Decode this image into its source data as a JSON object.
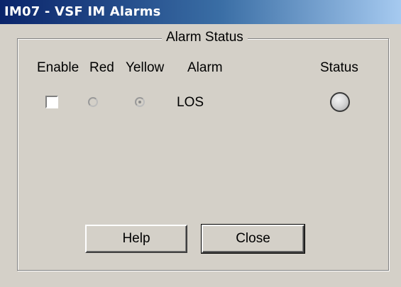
{
  "window": {
    "title": "IM07 - VSF IM Alarms"
  },
  "group": {
    "title": "Alarm Status"
  },
  "columns": {
    "enable": "Enable",
    "red": "Red",
    "yellow": "Yellow",
    "alarm": "Alarm",
    "status": "Status"
  },
  "alarms": [
    {
      "name": "LOS",
      "enabled": false,
      "severity": "yellow",
      "status_color": "#d8d8d8"
    }
  ],
  "buttons": {
    "help": "Help",
    "close": "Close"
  },
  "colors": {
    "titlebar_start": "#0a246a",
    "titlebar_end": "#a6caf0",
    "dialog_bg": "#d4d0c8"
  }
}
